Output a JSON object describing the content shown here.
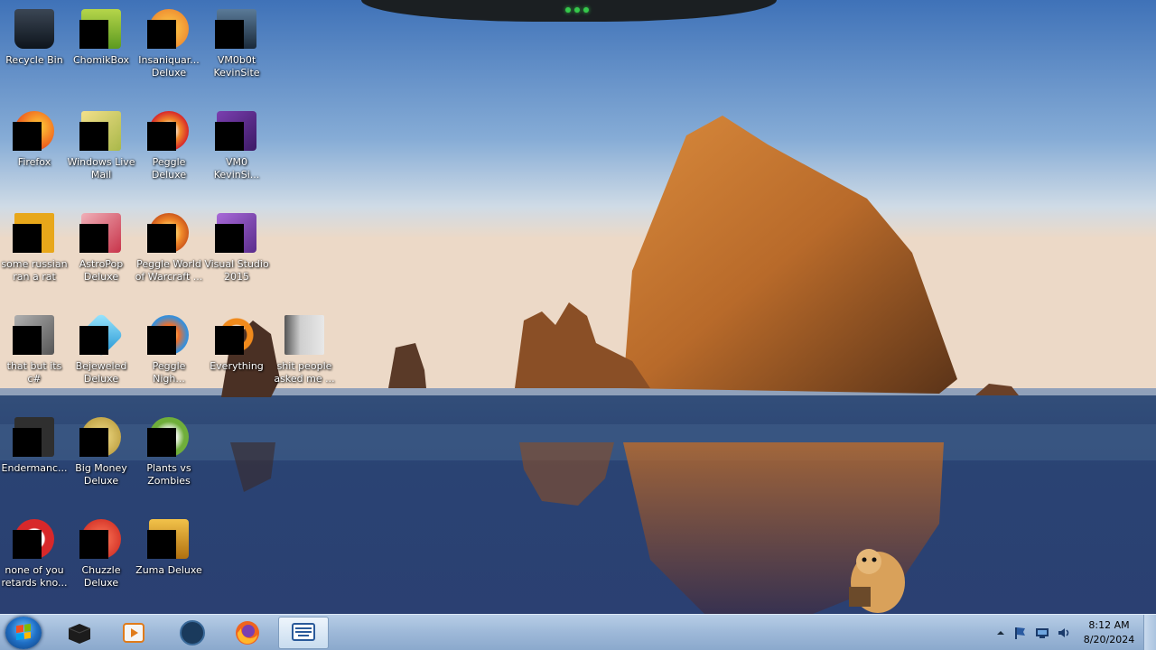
{
  "desktop_icons": [
    {
      "label": "Recycle Bin",
      "icon": "recycle-bin-icon",
      "color": "#1f2a36"
    },
    {
      "label": "ChomikBox",
      "icon": "chomikbox-icon",
      "color": "#7fb32a"
    },
    {
      "label": "Insaniquar... Deluxe",
      "icon": "insaniquarium-icon",
      "color": "#e9772a"
    },
    {
      "label": "VM0b0t KevinSite",
      "icon": "monitor-icon",
      "color": "#2a3c52"
    },
    {
      "label": "Firefox",
      "icon": "firefox-icon",
      "color": "#f07a1e"
    },
    {
      "label": "Windows Live Mail",
      "icon": "mail-icon",
      "color": "#d8c35a"
    },
    {
      "label": "Peggle Deluxe",
      "icon": "peggle-icon",
      "color": "#e03a2c"
    },
    {
      "label": "VM0 KevinSi...",
      "icon": "visual-studio-icon",
      "color": "#5b2d8c"
    },
    {
      "label": "some russian ran a rat",
      "icon": "rat-icon",
      "color": "#e8a71a"
    },
    {
      "label": "AstroPop Deluxe",
      "icon": "astropop-icon",
      "color": "#c8344a"
    },
    {
      "label": "Peggle World of Warcraft ...",
      "icon": "peggle-wow-icon",
      "color": "#e2622a"
    },
    {
      "label": "Visual Studio 2015",
      "icon": "visual-studio-icon",
      "color": "#7b3fb0"
    },
    {
      "label": "that but its c#",
      "icon": "stacked-windows-icon",
      "color": "#8c8c8c"
    },
    {
      "label": "Bejeweled Deluxe",
      "icon": "bejeweled-icon",
      "color": "#2fb5e6"
    },
    {
      "label": "Peggle Nigh...",
      "icon": "peggle-nights-icon",
      "color": "#3a8fd8"
    },
    {
      "label": "Everything",
      "icon": "everything-search-icon",
      "color": "#f08a1c"
    },
    {
      "label": "shit people asked me ...",
      "icon": "folder-icon",
      "color": "#8d8f8a"
    },
    {
      "label": "Endermanc...",
      "icon": "console-icon",
      "color": "#3a3a3a"
    },
    {
      "label": "Big Money Deluxe",
      "icon": "big-money-icon",
      "color": "#c8b050"
    },
    {
      "label": "Plants vs Zombies",
      "icon": "plants-vs-zombies-icon",
      "color": "#6fae3a"
    },
    {
      "label": "none of you retards kno...",
      "icon": "red-circle-icon",
      "color": "#d8282a"
    },
    {
      "label": "Chuzzle Deluxe",
      "icon": "chuzzle-icon",
      "color": "#e0382a"
    },
    {
      "label": "Zuma Deluxe",
      "icon": "zuma-icon",
      "color": "#d99a20"
    }
  ],
  "taskbar": {
    "start_button": "start-orb-icon",
    "pinned": [
      {
        "name": "black-box-app-icon",
        "active": false
      },
      {
        "name": "media-player-icon",
        "active": false
      },
      {
        "name": "globe-app-icon",
        "active": false
      },
      {
        "name": "firefox-icon",
        "active": false
      },
      {
        "name": "keyboard-app-icon",
        "active": true
      }
    ],
    "tray": {
      "icons": [
        "show-hidden-icons-chevron-icon",
        "flag-icon",
        "network-icon",
        "volume-icon"
      ],
      "time": "8:12 AM",
      "date": "8/20/2024"
    }
  },
  "colors": {
    "taskbar": "#9db8d8",
    "text": "#ffffff"
  }
}
